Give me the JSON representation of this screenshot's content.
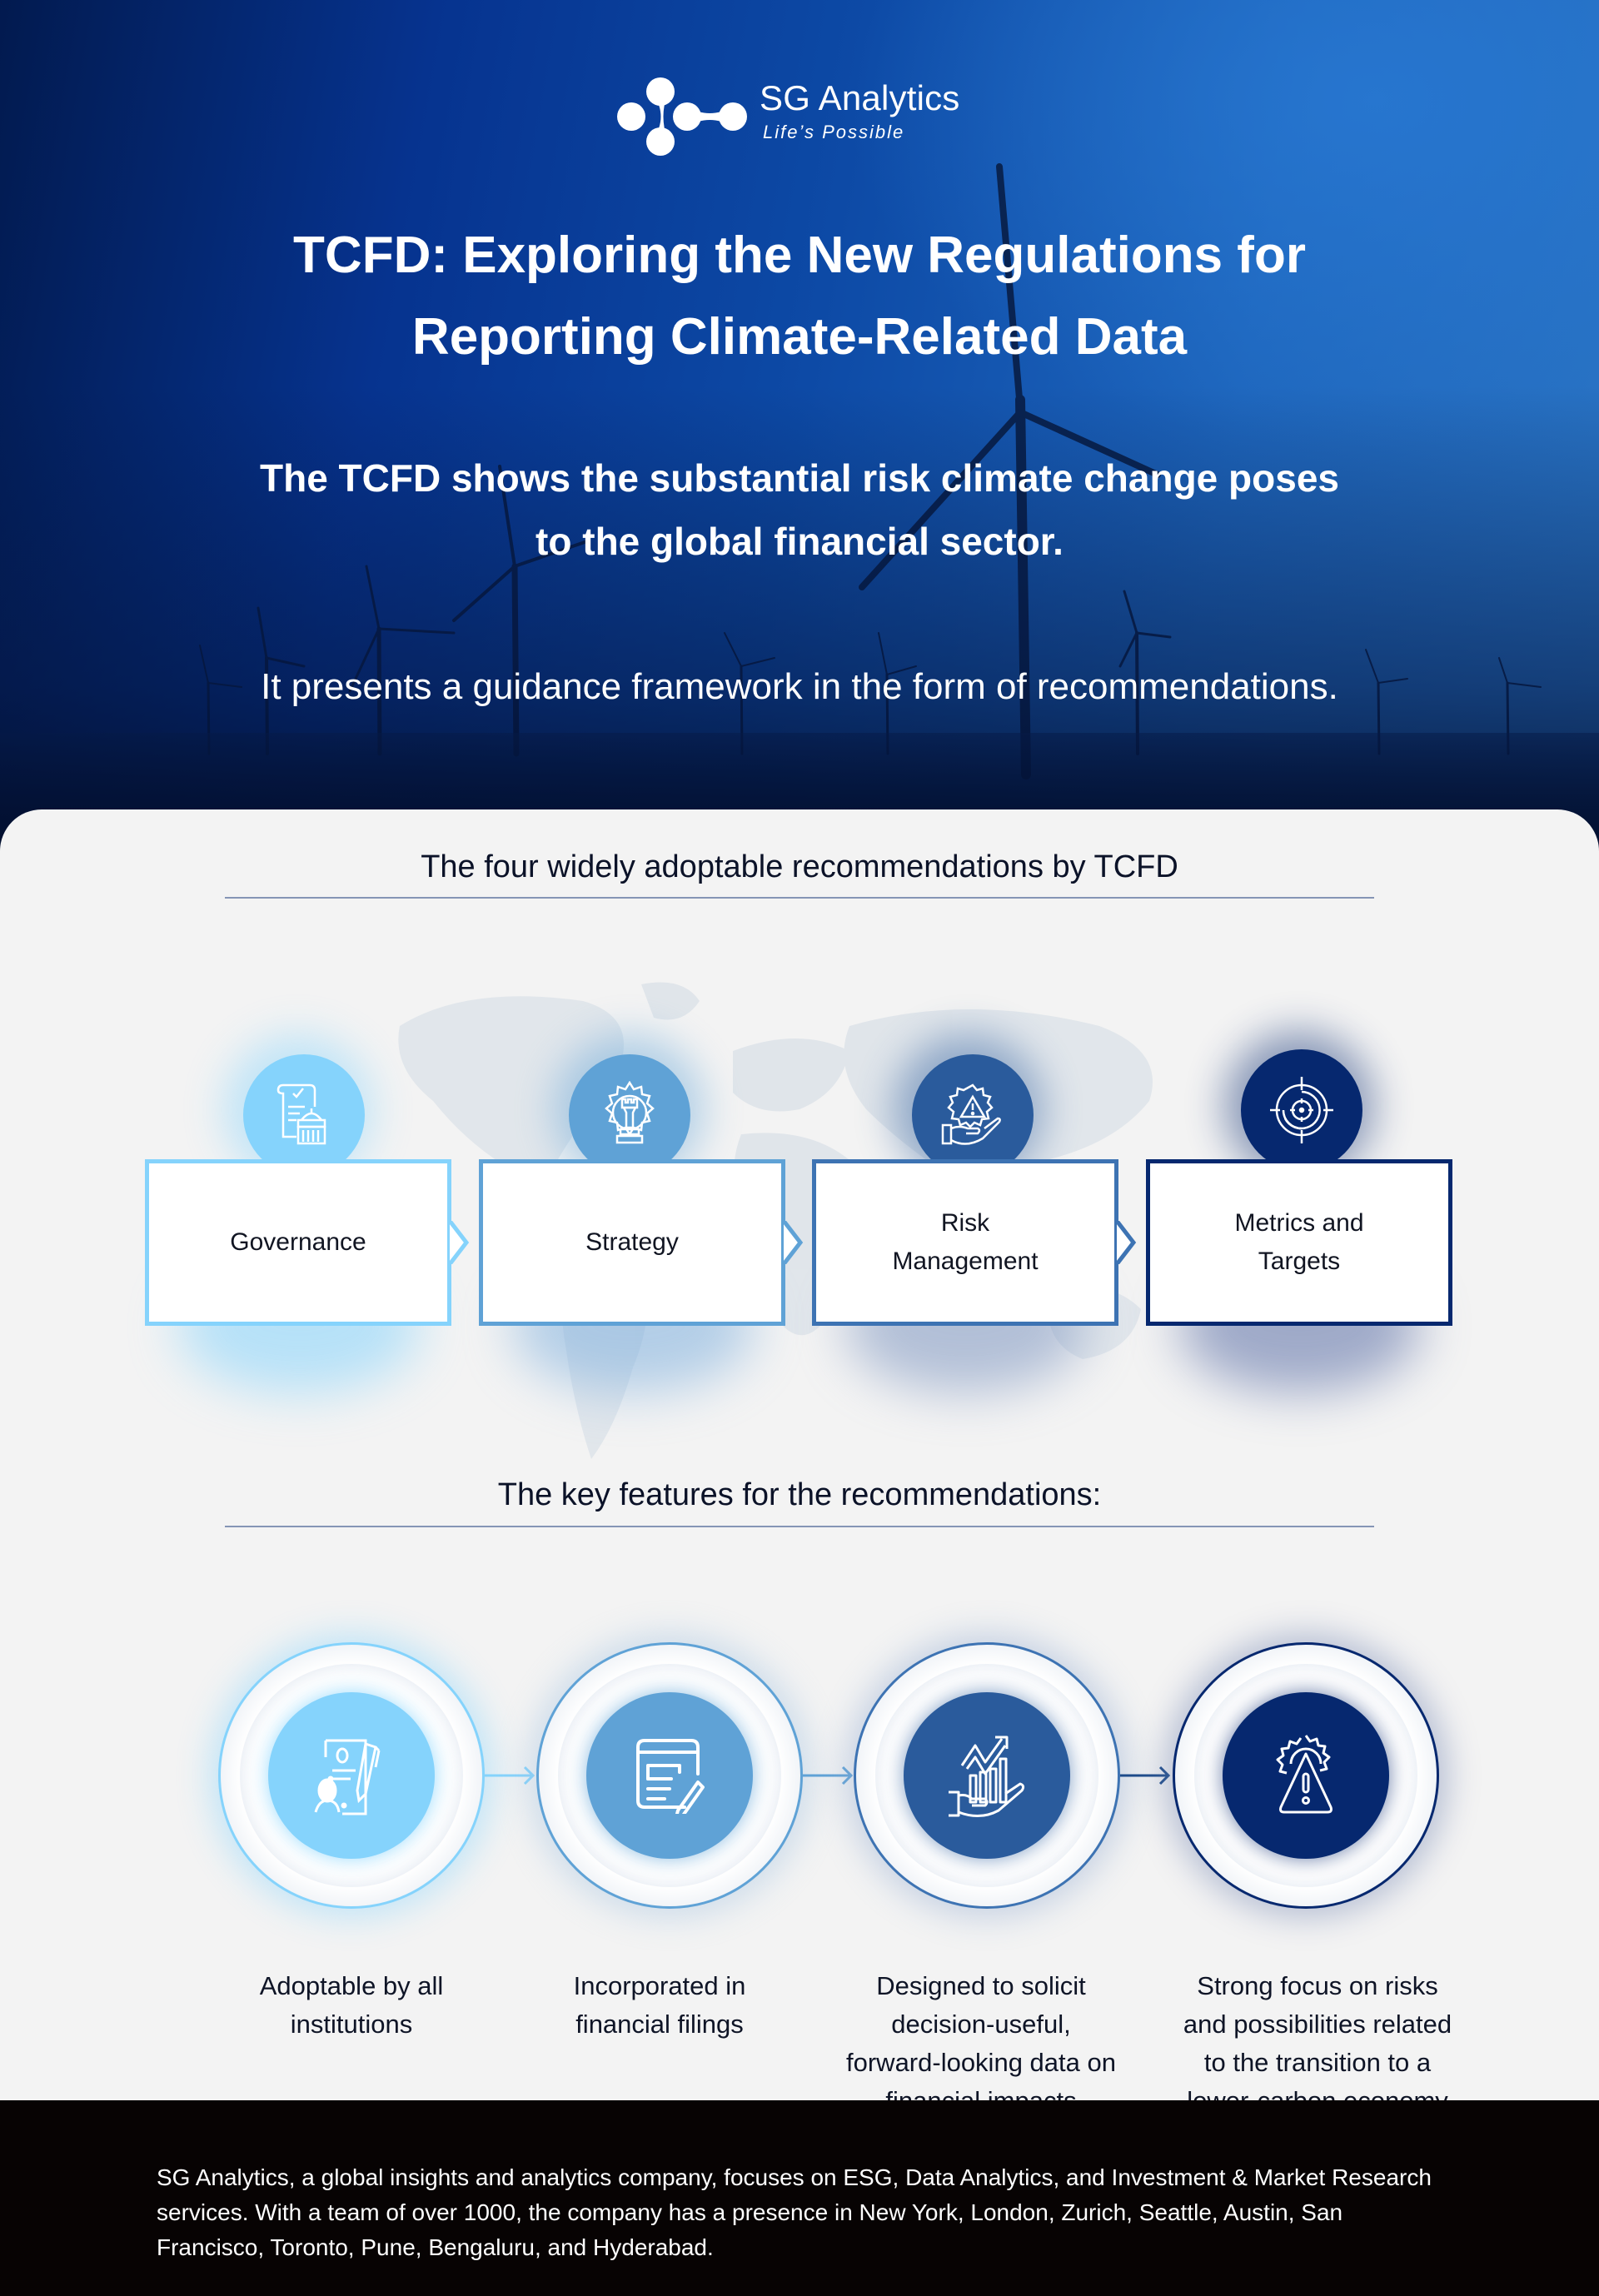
{
  "brand": {
    "name": "SG Analytics",
    "tagline": "Life’s Possible"
  },
  "hero": {
    "title_lines": [
      "TCFD: Exploring the New Regulations for",
      "Reporting Climate-Related Data"
    ],
    "subtitle_lines": [
      "The TCFD shows the substantial risk climate change poses",
      "to the global financial sector."
    ],
    "framework_line": "It presents a guidance framework in the form of recommendations."
  },
  "recommendations": {
    "heading": "The four widely adoptable recommendations by TCFD",
    "items": [
      {
        "label_lines": [
          "Governance"
        ],
        "icon": "governance-document-building-icon",
        "color": "#85d3fc"
      },
      {
        "label_lines": [
          "Strategy"
        ],
        "icon": "strategy-chess-gear-icon",
        "color": "#5fa2d6"
      },
      {
        "label_lines": [
          "Risk",
          "Management"
        ],
        "icon": "risk-hand-gear-warning-icon",
        "color": "#2a5b9c"
      },
      {
        "label_lines": [
          "Metrics and",
          "Targets"
        ],
        "icon": "target-crosshair-icon",
        "color": "#06286f"
      }
    ]
  },
  "features": {
    "heading": "The key features for the recommendations:",
    "items": [
      {
        "caption_lines": [
          "Adoptable by all",
          "institutions"
        ],
        "icon": "person-signing-document-icon",
        "color": "#85d3fc"
      },
      {
        "caption_lines": [
          "Incorporated in",
          "financial filings"
        ],
        "icon": "document-edit-icon",
        "color": "#5fa2d6"
      },
      {
        "caption_lines": [
          "Designed to solicit",
          "decision-useful,",
          "forward-looking data on",
          "financial impacts"
        ],
        "icon": "hand-growth-chart-icon",
        "color": "#2a5b9c"
      },
      {
        "caption_lines": [
          "Strong focus on risks",
          "and possibilities related",
          "to the transition to a",
          "lower-carbon economy"
        ],
        "icon": "gear-warning-triangle-icon",
        "color": "#06286f"
      }
    ]
  },
  "footer": {
    "text": "SG Analytics, a global insights and analytics company, focuses on ESG, Data Analytics, and Investment & Market Research services. With a team of over 1000, the company has a presence in New York, London, Zurich, Seattle, Austin, San Francisco, Toronto, Pune, Bengaluru, and Hyderabad."
  },
  "colors": {
    "hero_dark": "#021a4f",
    "hero_light": "#2a74c4",
    "card_bg": "#f3f3f3",
    "heading_text": "#0b1228",
    "rule": "#8595b5",
    "footer_bg": "#070303",
    "step_1": "#85d3fc",
    "step_2": "#5fa2d6",
    "step_3": "#2a5b9c",
    "step_4": "#06286f"
  }
}
